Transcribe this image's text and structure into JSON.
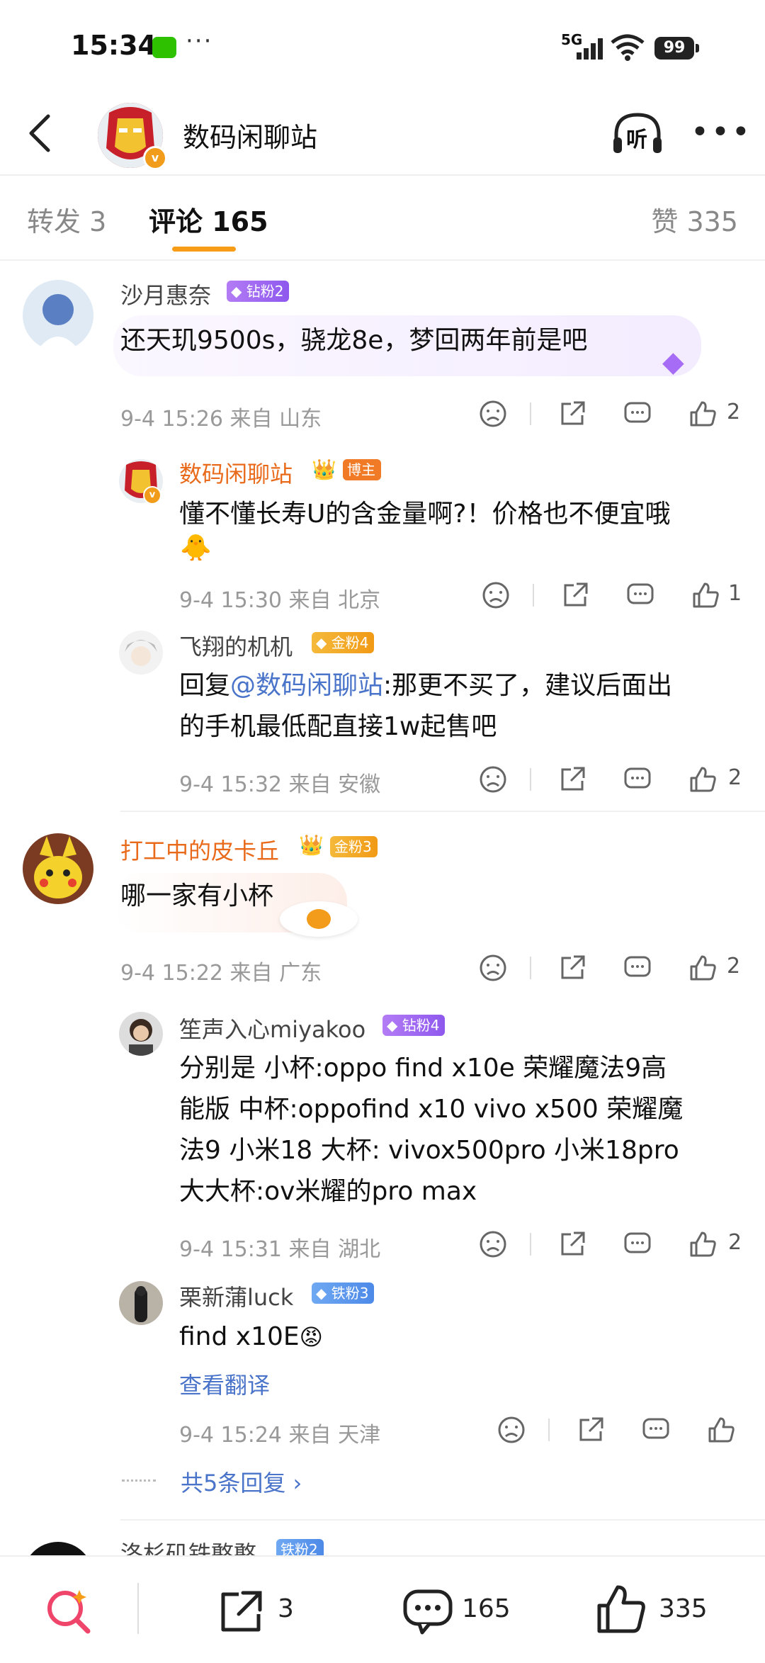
{
  "status": {
    "time": "15:34",
    "dots": "···",
    "network": "5G",
    "battery": "99"
  },
  "header": {
    "title": "数码闲聊站",
    "listen_label": "听"
  },
  "tabs": {
    "repost": "转发 3",
    "comments": "评论 165",
    "likes": "赞 335"
  },
  "comments": [
    {
      "user": "沙月惠奈",
      "badge": "钻粉2",
      "text": "还天玑9500s，骁龙8e，梦回两年前是吧",
      "time": "9-4 15:26",
      "location": "来自 山东",
      "likes": "2"
    },
    {
      "user": "数码闲聊站",
      "badge": "博主",
      "text": "懂不懂长寿U的含金量啊?！价格也不便宜哦",
      "time": "9-4 15:30",
      "location": "来自 北京",
      "likes": "1"
    },
    {
      "user": "飞翔的机机",
      "badge": "金粉4",
      "reply_prefix": "回复",
      "mention": "@数码闲聊站",
      "text_line1": ":那更不买了，建议后面出",
      "text_line2": "的手机最低配直接1w起售吧",
      "time": "9-4 15:32",
      "location": "来自 安徽",
      "likes": "2"
    },
    {
      "user": "打工中的皮卡丘",
      "badge": "金粉3",
      "text": "哪一家有小杯",
      "time": "9-4 15:22",
      "location": "来自 广东",
      "likes": "2"
    },
    {
      "user": "笙声入心miyakoo",
      "badge": "钻粉4",
      "lines": [
        "分别是 小杯:oppo find x10e  荣耀魔法9高",
        "能版 中杯:oppofind x10  vivo x500  荣耀魔",
        "法9  小米18 大杯: vivox500pro  小米18pro",
        "大大杯:ov米耀的pro max"
      ],
      "time": "9-4 15:31",
      "location": "来自 湖北",
      "likes": "2"
    },
    {
      "user": "栗新蒲luck",
      "badge": "铁粉3",
      "text": "find x10E",
      "translate": "查看翻译",
      "time": "9-4 15:24",
      "location": "来自 天津",
      "likes": ""
    }
  ],
  "more_replies": "共5条回复",
  "partial_next": {
    "user": "洛杉矶铁憨憨",
    "badge": "铁粉2"
  },
  "bottom_bar": {
    "repost_count": "3",
    "comment_count": "165",
    "like_count": "335"
  },
  "colors": {
    "accent": "#f79c17",
    "link": "#4a74c9",
    "author": "#e86a1a"
  },
  "icons": [
    "back-icon",
    "listen-icon",
    "more-icon",
    "dislike-icon",
    "share-icon",
    "comment-icon",
    "like-icon",
    "search-sparkle-icon",
    "repost-icon",
    "comment-bubble-icon",
    "thumbs-up-icon"
  ]
}
